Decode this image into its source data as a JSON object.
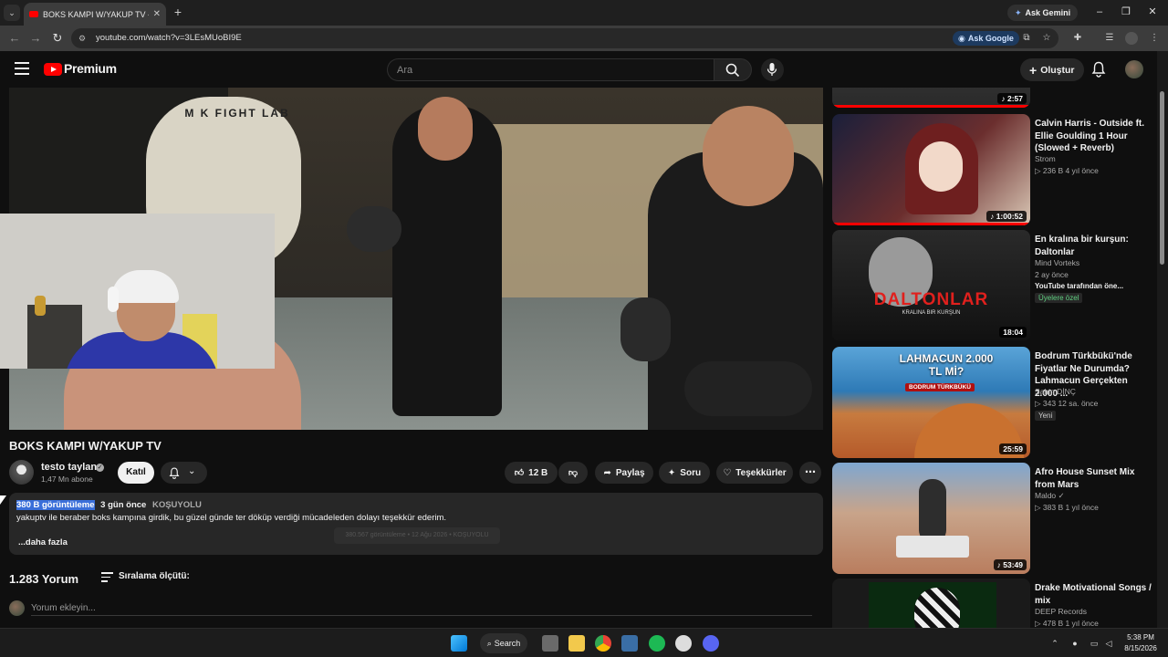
{
  "browser": {
    "tab_title": "BOKS KAMPI W/YAKUP TV - YouTube",
    "url": "youtube.com/watch?v=3LEsMUoBI9E",
    "ask_gemini": "Ask Gemini",
    "ask_google": "Ask Google"
  },
  "masthead": {
    "logo_text": "Premium",
    "search_placeholder": "Ara",
    "create_label": "Oluştur"
  },
  "player": {
    "pad_text": "M K FIGHT LAB"
  },
  "video": {
    "title": "BOKS KAMPI W/YAKUP TV",
    "channel": "testo taylan",
    "subscribers": "1,47 Mn abone",
    "join_label": "Katıl",
    "likes": "12 B",
    "share_label": "Paylaş",
    "ask_label": "Soru",
    "thanks_label": "Teşekkürler"
  },
  "description": {
    "views": "380 B görüntüleme",
    "age": "3 gün önce",
    "category": "KOŞUYOLU",
    "text": "yakuptv ile beraber boks kampına girdik, bu güzel günde ter döküp verdiği mücadeleden dolayı teşekkür ederim.",
    "more": "...daha fazla",
    "ghost_tooltip": "380.567 görüntüleme • 12 Ağu 2026 • KOŞUYOLU"
  },
  "comments": {
    "count": "1.283 Yorum",
    "sort_label": "Sıralama ölçütü:",
    "input_placeholder": "Yorum ekleyin..."
  },
  "recommendations": [
    {
      "title": "",
      "duration": "2:57",
      "channel": "",
      "meta": ""
    },
    {
      "title": "Calvin Harris - Outside ft. Ellie Goulding 1 Hour (Slowed + Reverb)",
      "channel": "Strom",
      "meta": "▷ 236 B   4 yıl önce",
      "duration": "1:00:52"
    },
    {
      "title": "En kralına bir kurşun: Daltonlar",
      "channel": "Mind Vorteks",
      "meta": "2 ay önce",
      "extra": "YouTube tarafından öne...",
      "badge": "Üyelere özel",
      "duration": "18:04",
      "thumb_text": "DALTONLAR",
      "thumb_sub": "KRALINA BIR KURŞUN"
    },
    {
      "title": "Bodrum Türkbükü'nde Fiyatlar Ne Durumda? Lahmacun Gerçekten 2.000 ...",
      "channel": "Şahin DİNÇ",
      "meta": "▷ 343   12 sa. önce",
      "badge": "Yeni",
      "duration": "25:59",
      "thumb_text": "LAHMACUN 2.000 TL Mİ?",
      "thumb_sub": "BODRUM TÜRKBÜKÜ"
    },
    {
      "title": "Afro House Sunset Mix from Mars",
      "channel": "Maldo",
      "meta": "▷ 383 B   1 yıl önce",
      "duration": "53:49"
    },
    {
      "title": "Drake Motivational Songs / mix",
      "channel": "DEEP Records",
      "meta": "▷ 478 B   1 yıl önce"
    }
  ],
  "taskbar": {
    "search": "Search",
    "time": "5:38 PM",
    "date": "8/15/2026"
  },
  "colors": {
    "youtube_red": "#ff0000",
    "background": "#0f0f0f",
    "chip": "#272727",
    "highlight": "#3a6fd9"
  }
}
